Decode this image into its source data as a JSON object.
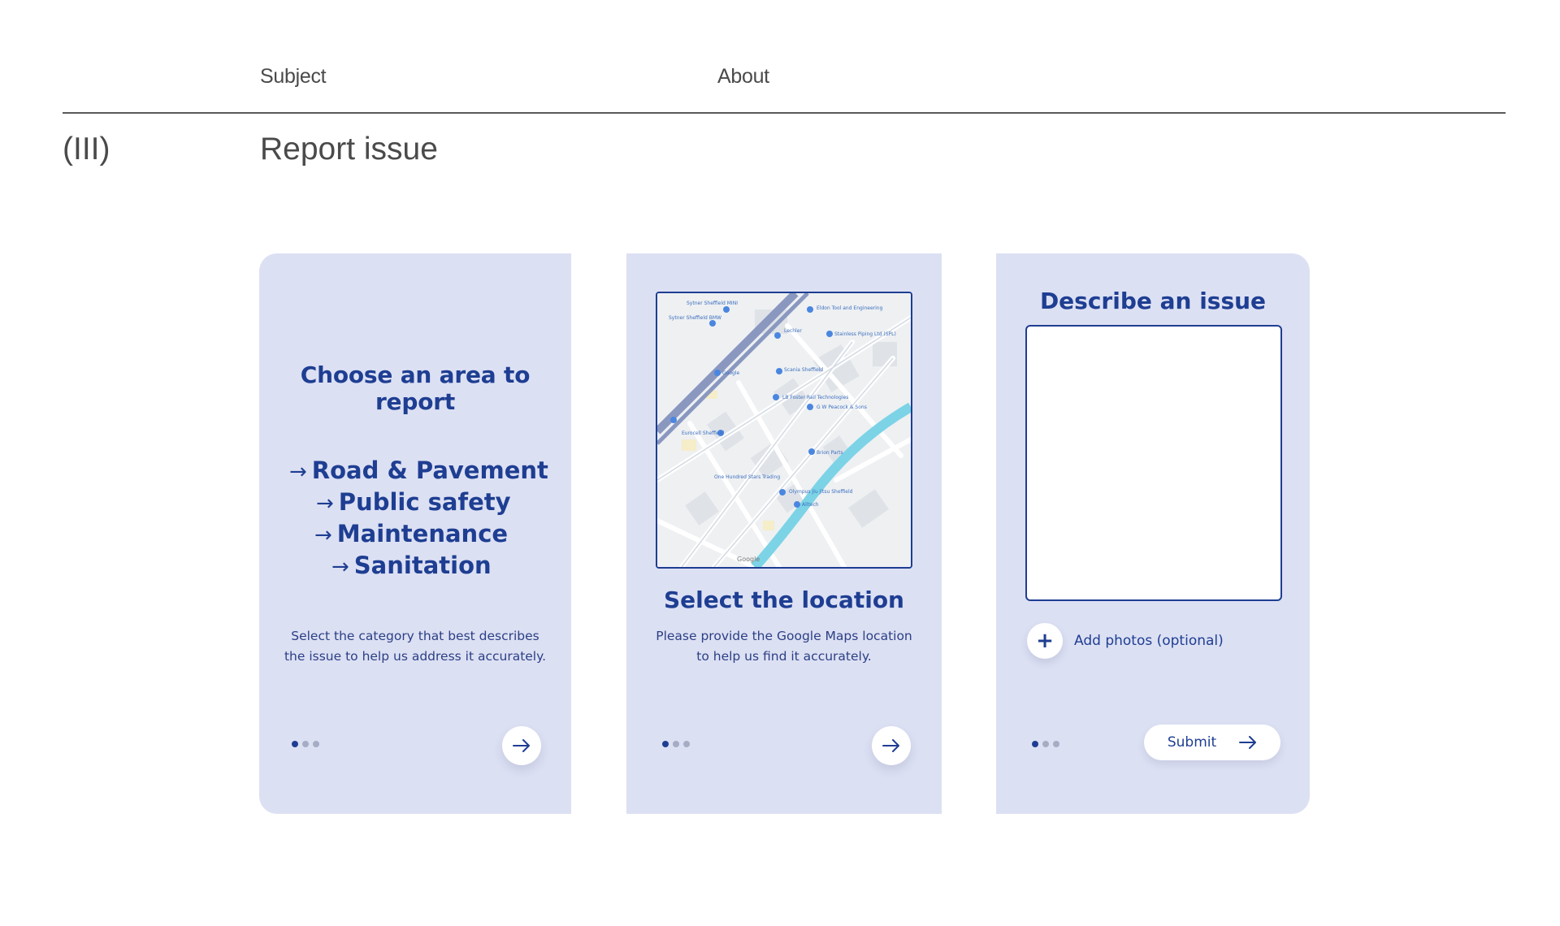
{
  "header": {
    "subject_label": "Subject",
    "about_label": "About",
    "section_number": "(III)",
    "section_title": "Report issue"
  },
  "cards": {
    "category": {
      "heading": "Choose an area to report",
      "categories": [
        "Road & Pavement",
        "Public safety",
        "Maintenance",
        "Sanitation"
      ],
      "description_line1": "Select the category that best describes",
      "description_line2": "the issue to help us address it accurately.",
      "page_indicator": {
        "total": 3,
        "active": 1
      }
    },
    "location": {
      "heading": "Select the location",
      "description_line1": "Please provide the Google Maps location",
      "description_line2": "to help us find it accurately.",
      "map_labels": {
        "poi1": "Sytner Sheffield MINI",
        "poi2": "Sytner Sheffield BMW",
        "poi3": "Eldon Tool and Engineering",
        "poi4": "Stainless Piping Ltd (SPL)",
        "poi5": "Lechler",
        "poi6": "Scania Sheffield",
        "poi7": "LB Foster Rail Technologies",
        "poi8": "G W Peacock & Sons",
        "poi9": "Eurocell Sheffield",
        "poi10": "Brion Parts",
        "poi11": "One Hundred Stars Trading",
        "poi12": "Olympus Jiu Jitsu Sheffield",
        "poi13": "Alltech",
        "poi14": "Google"
      },
      "page_indicator": {
        "total": 3,
        "active": 1
      }
    },
    "describe": {
      "heading": "Describe an issue",
      "add_photos_label": "Add photos (optional)",
      "submit_label": "Submit",
      "page_indicator": {
        "total": 3,
        "active": 1
      }
    }
  },
  "icons": {
    "arrow": "arrow-right-icon",
    "plus": "plus-icon",
    "map_pin": "map-pin-icon"
  },
  "colors": {
    "accent": "#1e3e92",
    "card_bg": "#dce0f3",
    "river": "#7cd3e6",
    "rail": "#8a98c0"
  }
}
